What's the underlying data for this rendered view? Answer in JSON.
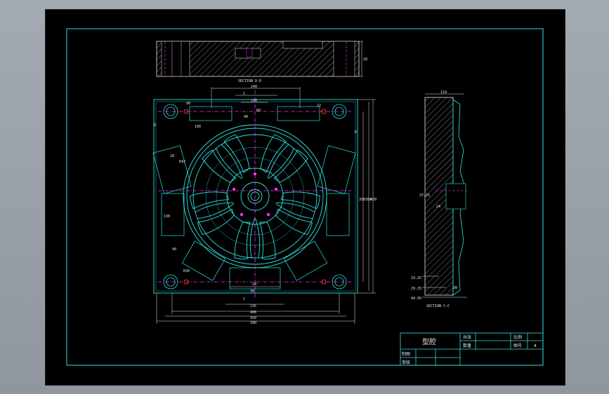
{
  "section_labels": {
    "top": "SECTION D-D",
    "right": "SECTION C-C"
  },
  "cut_markers": {
    "c": "C",
    "d": "D"
  },
  "dimensions": {
    "top_width_240": "240",
    "top_100_a": "100",
    "top_100_b": "100",
    "top_40": "40",
    "top_60": "60",
    "top_99": "99",
    "top_22": "22",
    "left_28": "28",
    "left_40": "40",
    "left_130": "130",
    "left_r30": "R30",
    "left_r42": "R42",
    "bottom_135": "135",
    "bottom_70": "70",
    "bottom_20": "20",
    "bottom_406": "406",
    "bottom_350": "350",
    "bottom_390": "390",
    "right_420": "420",
    "right_388": "388",
    "right_350": "350",
    "side_119": "119",
    "side_37_25": "37.25",
    "side_24": "24",
    "side_19_25": "19.25",
    "side_29_25": "29.25",
    "side_44_95": "44.95",
    "side_30": "30",
    "side_18": "18"
  },
  "title_block": {
    "part_name": "型腔",
    "quantity_label": "共张",
    "sheet_label": "数量",
    "scale_label": "比例",
    "drawing_no_label": "图号",
    "drawing_no_value": "4",
    "drawn_by_label": "制图",
    "checked_by_label": "审核"
  },
  "colors": {
    "frame": "#2fe0e0",
    "dimension": "#e8e8e8",
    "center_line": "#ff33ff",
    "hatch": "#e8e8e8",
    "background": "#000000"
  }
}
